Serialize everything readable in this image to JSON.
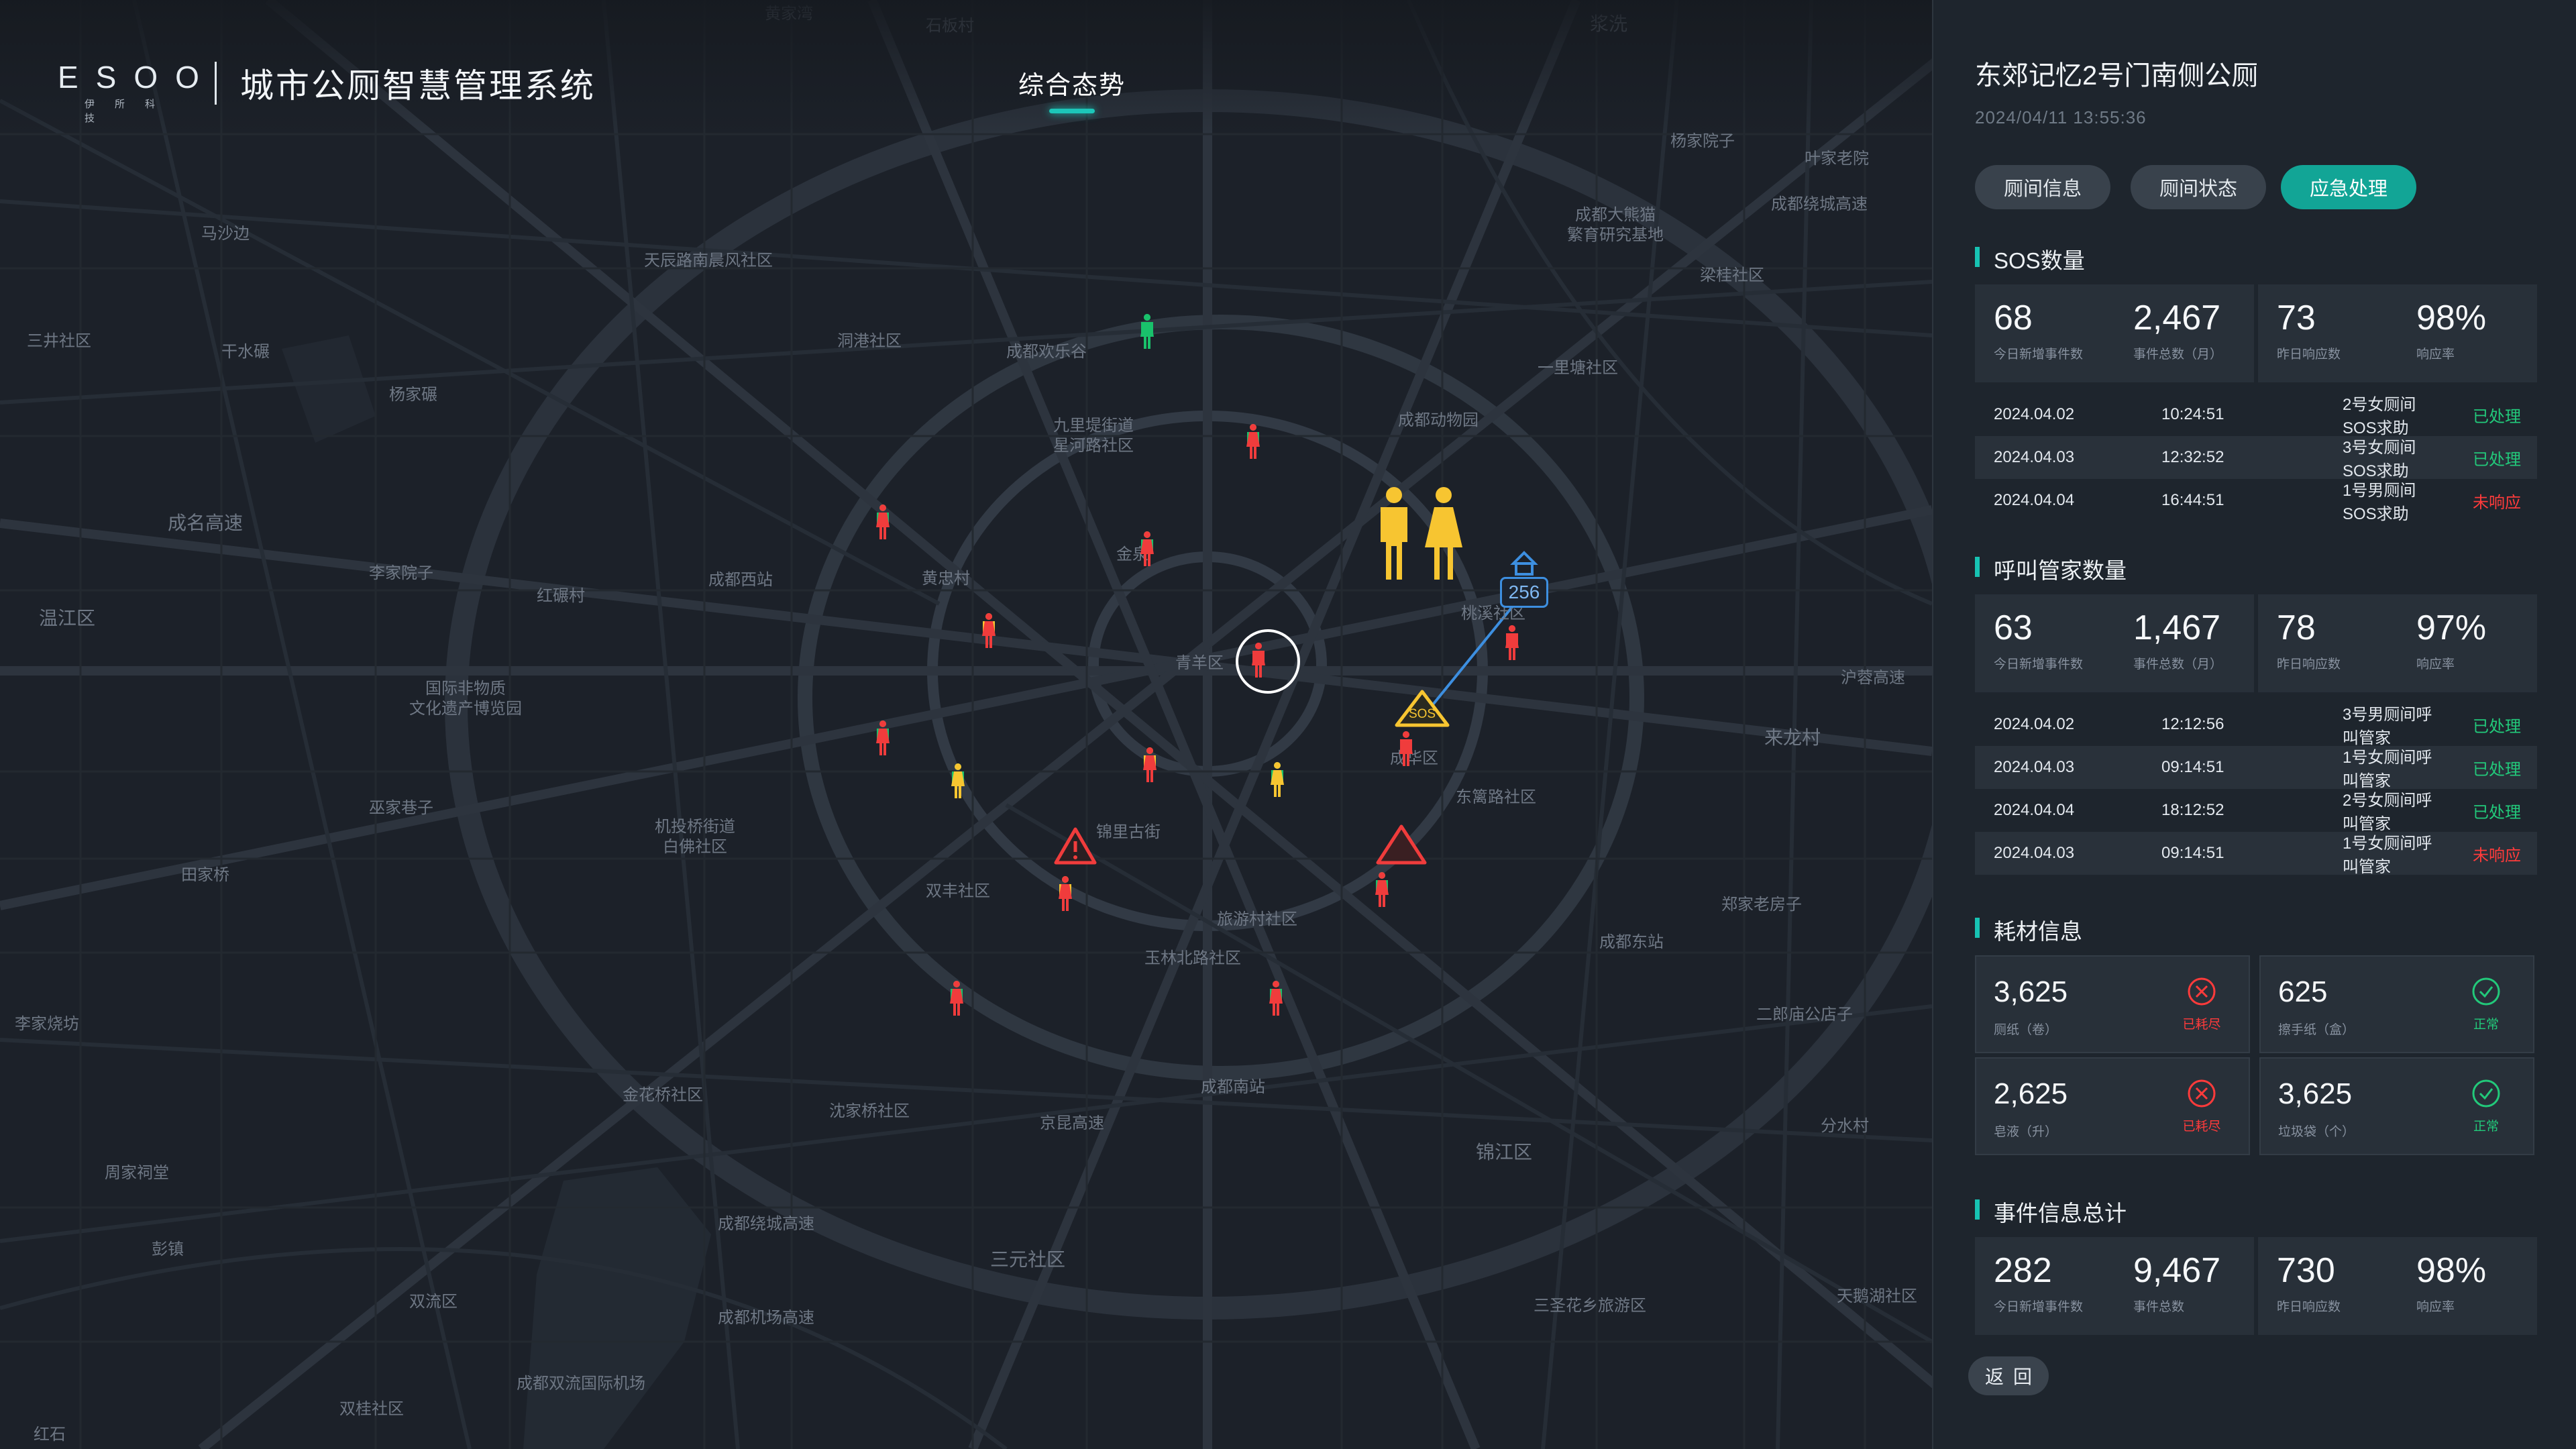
{
  "header": {
    "logo_text": "ESOO",
    "logo_subtext": "伊所科技",
    "system_title": "城市公厕智慧管理系统",
    "nav_tab": "综合态势"
  },
  "map": {
    "labels": [
      "黄家湾",
      "石板村",
      "马沙边",
      "三井社区",
      "干水碾",
      "杨家碾",
      "成名高速",
      "李家院子",
      "温江区",
      "红碾村",
      "天辰路南晨风社区",
      "洞港社区",
      "成都欢乐谷",
      "九里堤街道 星河路社区",
      "成都西站",
      "黄忠村",
      "青羊区",
      "国际非物质 文化遗产博览园",
      "巫家巷子",
      "机投桥街道 白佛社区",
      "田家桥",
      "双丰社区",
      "锦里古街",
      "旅游村社区",
      "玉林北路社区",
      "金花桥社区",
      "沈家桥社区",
      "成都南站",
      "三元社区",
      "双流区",
      "成都双流国际机场",
      "双桂社区",
      "红石",
      "彭镇",
      "周家祠堂",
      "李家烧坊",
      "成都动物园",
      "一里塘社区",
      "成都大熊猫 繁育研究基地",
      "梁桂社区",
      "叶家老院",
      "杨家院子",
      "来龙村",
      "东篱路社区",
      "郑家老房子",
      "成都东站",
      "二郎庙公店子",
      "分水村",
      "锦江区",
      "三圣花乡旅游区",
      "天鹅湖社区",
      "沪蓉高速",
      "成都绕城高速",
      "成都机场高速",
      "京昆高速",
      "成都绕城高速",
      "成华区",
      "桃溪社区",
      "金泉",
      "浆洗"
    ],
    "sos_label": "SOS",
    "cluster_count": "256"
  },
  "panel": {
    "location_title": "东郊记忆2号门南侧公厕",
    "datetime": "2024/04/11  13:55:36",
    "tabs": [
      "厕间信息",
      "厕间状态",
      "应急处理"
    ],
    "sos": {
      "title": "SOS数量",
      "stats": [
        {
          "value": "68",
          "caption": "今日新增事件数"
        },
        {
          "value": "2,467",
          "caption": "事件总数（月）"
        },
        {
          "value": "73",
          "caption": "昨日响应数"
        },
        {
          "value": "98%",
          "caption": "响应率"
        }
      ],
      "events": [
        {
          "date": "2024.04.02",
          "time": "10:24:51",
          "event": "2号女厕间SOS求助",
          "status": "已处理"
        },
        {
          "date": "2024.04.03",
          "time": "12:32:52",
          "event": "3号女厕间SOS求助",
          "status": "已处理"
        },
        {
          "date": "2024.04.04",
          "time": "16:44:51",
          "event": "1号男厕间SOS求助",
          "status": "未响应"
        }
      ]
    },
    "call": {
      "title": "呼叫管家数量",
      "stats": [
        {
          "value": "63",
          "caption": "今日新增事件数"
        },
        {
          "value": "1,467",
          "caption": "事件总数（月）"
        },
        {
          "value": "78",
          "caption": "昨日响应数"
        },
        {
          "value": "97%",
          "caption": "响应率"
        }
      ],
      "events": [
        {
          "date": "2024.04.02",
          "time": "12:12:56",
          "event": "3号男厕间呼叫管家",
          "status": "已处理"
        },
        {
          "date": "2024.04.03",
          "time": "09:14:51",
          "event": "1号女厕间呼叫管家",
          "status": "已处理"
        },
        {
          "date": "2024.04.04",
          "time": "18:12:52",
          "event": "2号女厕间呼叫管家",
          "status": "已处理"
        },
        {
          "date": "2024.04.03",
          "time": "09:14:51",
          "event": "1号女厕间呼叫管家",
          "status": "未响应"
        }
      ]
    },
    "consumables": {
      "title": "耗材信息",
      "items": [
        {
          "value": "3,625",
          "caption": "厕纸（卷）",
          "status": "已耗尽",
          "state": "depleted"
        },
        {
          "value": "625",
          "caption": "擦手纸（盒）",
          "status": "正常",
          "state": "normal"
        },
        {
          "value": "2,625",
          "caption": "皂液（升）",
          "status": "已耗尽",
          "state": "depleted"
        },
        {
          "value": "3,625",
          "caption": "垃圾袋（个）",
          "status": "正常",
          "state": "normal"
        }
      ]
    },
    "totals": {
      "title": "事件信息总计",
      "stats": [
        {
          "value": "282",
          "caption": "今日新增事件数"
        },
        {
          "value": "9,467",
          "caption": "事件总数"
        },
        {
          "value": "730",
          "caption": "昨日响应数"
        },
        {
          "value": "98%",
          "caption": "响应率"
        }
      ]
    },
    "back_label": "返回"
  },
  "colors": {
    "accent": "#12a596",
    "ok": "#22c97a",
    "alert": "#ff3b3b",
    "male_normal": "#19c16b",
    "female_alert": "#f03c3c",
    "warn": "#f7c531",
    "link": "#3d8fe0"
  }
}
